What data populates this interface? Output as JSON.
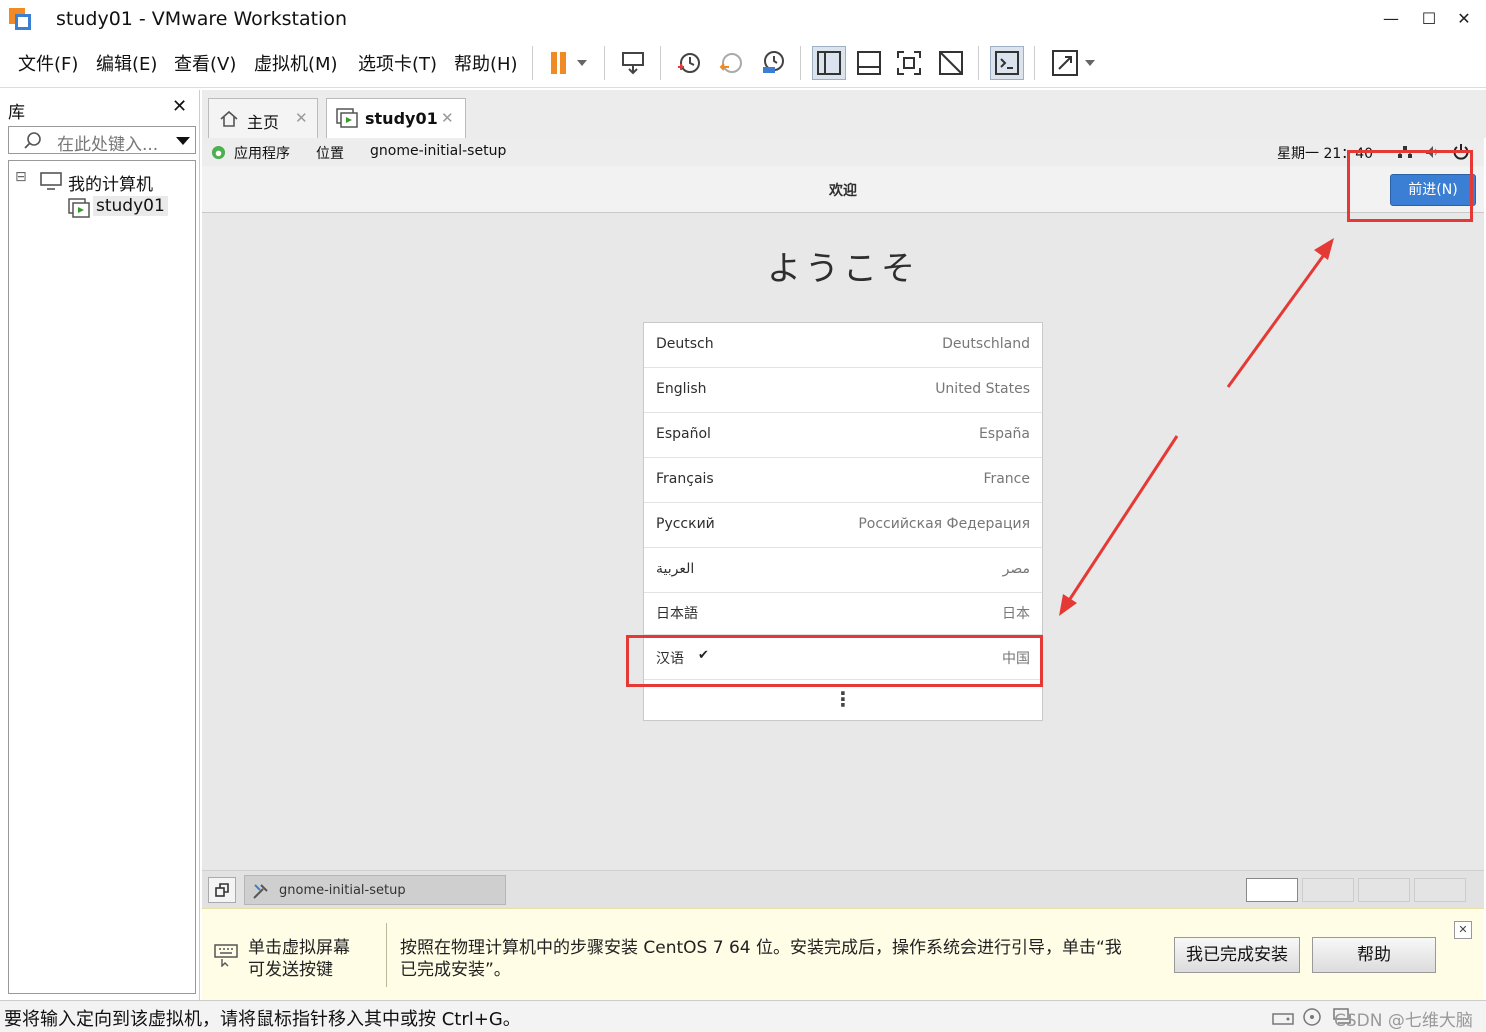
{
  "window": {
    "title": "study01 - VMware Workstation",
    "min_glyph": "—",
    "max_glyph": "☐",
    "close_glyph": "✕"
  },
  "menu": {
    "items": [
      "文件(F)",
      "编辑(E)",
      "查看(V)",
      "虚拟机(M)",
      "选项卡(T)",
      "帮助(H)"
    ]
  },
  "library": {
    "title": "库",
    "close_glyph": "✕",
    "search_placeholder": "在此处键入...",
    "tree": {
      "root_label": "我的计算机",
      "child_label": "study01",
      "expander": "⊟"
    }
  },
  "tabs": {
    "home_label": "主页",
    "vm_label": "study01",
    "close_glyph": "✕"
  },
  "guest": {
    "topbar": {
      "apps": "应用程序",
      "places": "位置",
      "app_name": "gnome-initial-setup",
      "clock": "星期一 21：40"
    },
    "header_title": "欢迎",
    "next_button": "前进(N)",
    "welcome_heading": "ようこそ",
    "languages": [
      {
        "name": "Deutsch",
        "region": "Deutschland",
        "selected": false
      },
      {
        "name": "English",
        "region": "United States",
        "selected": false
      },
      {
        "name": "Español",
        "region": "España",
        "selected": false
      },
      {
        "name": "Français",
        "region": "France",
        "selected": false
      },
      {
        "name": "Русский",
        "region": "Российская Федерация",
        "selected": false
      },
      {
        "name": "العربية",
        "region": "مصر",
        "selected": false
      },
      {
        "name": "日本語",
        "region": "日本",
        "selected": false
      },
      {
        "name": "汉语",
        "region": "中国",
        "selected": true
      }
    ],
    "more_glyph": "⋮",
    "check_glyph": "✔"
  },
  "vm_status": {
    "taskbar_item": "gnome-initial-setup"
  },
  "hint": {
    "left_text_1": "单击虚拟屏幕",
    "left_text_2": "可发送按键",
    "main_text_1": "按照在物理计算机中的步骤安装 CentOS 7 64 位。安装完成后，操作系统会进行引导，单击“我",
    "main_text_2": "已完成安装”。",
    "done_button": "我已完成安装",
    "help_button": "帮助",
    "close_glyph": "✕"
  },
  "statusbar": {
    "text": "要将输入定向到该虚拟机，请将鼠标指针移入其中或按 Ctrl+G。",
    "watermark": "CSDN @七维大脑"
  },
  "colors": {
    "accent_blue": "#3b7fd4",
    "annotation_red": "#e53935",
    "pause_orange": "#f08a24"
  }
}
